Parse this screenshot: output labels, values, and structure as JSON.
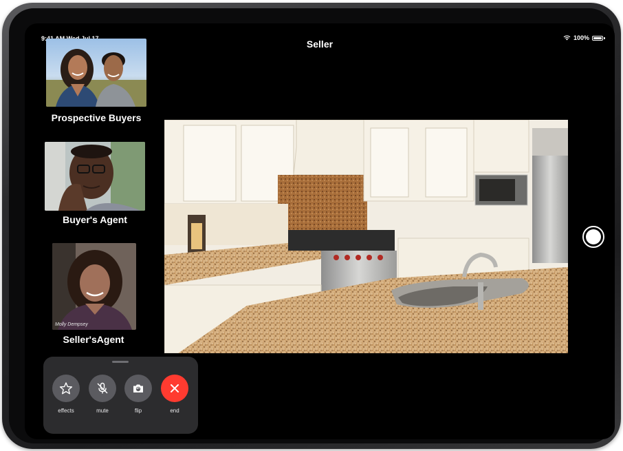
{
  "status_bar": {
    "time_date": "9:41 AM   Wed Jul 17",
    "battery": "100%",
    "wifi_icon": "wifi-icon",
    "battery_icon": "battery-icon"
  },
  "call": {
    "title": "Seller"
  },
  "participants": [
    {
      "label": "Prospective Buyers"
    },
    {
      "label": "Buyer's Agent"
    },
    {
      "label": "Seller'sAgent",
      "caption": "Molly Dempsey"
    }
  ],
  "controls": [
    {
      "label": "effects",
      "icon": "star-icon"
    },
    {
      "label": "mute",
      "icon": "mic-off-icon"
    },
    {
      "label": "flip",
      "icon": "camera-flip-icon"
    },
    {
      "label": "end",
      "icon": "close-icon",
      "color": "#ff3b30"
    }
  ],
  "shutter_icon": "shutter-icon"
}
